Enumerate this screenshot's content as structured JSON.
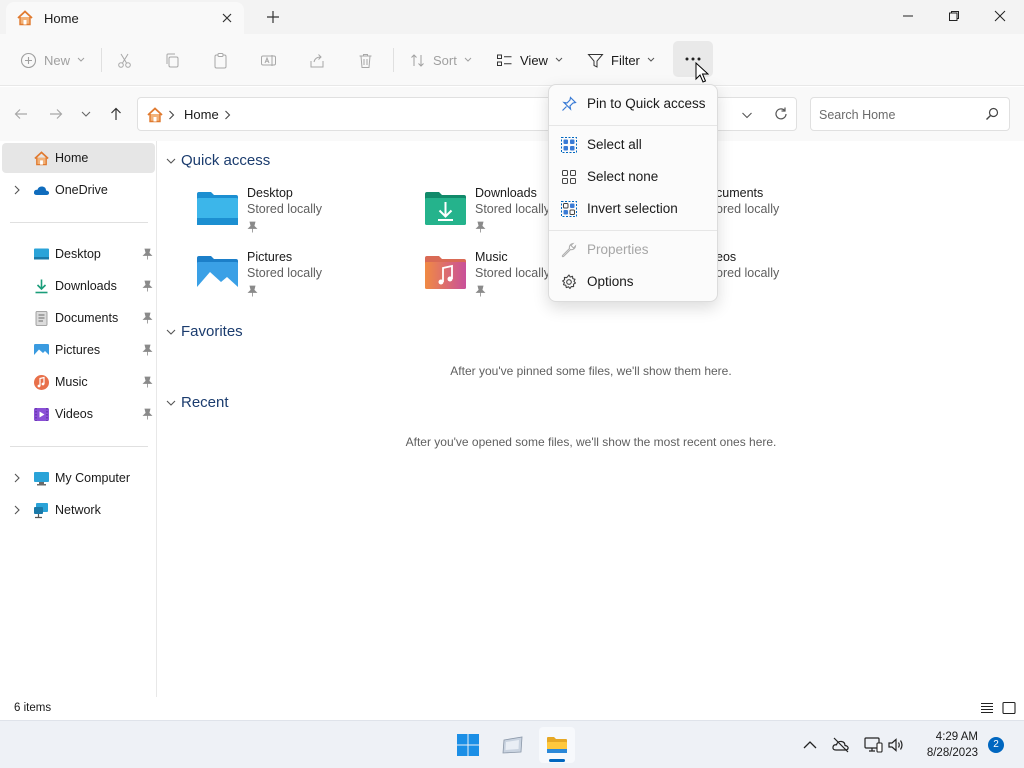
{
  "window": {
    "tab_title": "Home",
    "new_tab_label": "+"
  },
  "commandbar": {
    "new_label": "New",
    "sort_label": "Sort",
    "view_label": "View",
    "filter_label": "Filter",
    "more_label": "..."
  },
  "address": {
    "crumb": "Home",
    "search_placeholder": "Search Home"
  },
  "sidebar": {
    "home": "Home",
    "onedrive": "OneDrive",
    "desktop": "Desktop",
    "downloads": "Downloads",
    "documents": "Documents",
    "pictures": "Pictures",
    "music": "Music",
    "videos": "Videos",
    "my_computer": "My Computer",
    "network": "Network"
  },
  "content": {
    "quick_access_label": "Quick access",
    "favorites_label": "Favorites",
    "recent_label": "Recent",
    "favorites_empty": "After you've pinned some files, we'll show them here.",
    "recent_empty": "After you've opened some files, we'll show the most recent ones here.",
    "tiles": [
      {
        "name": "Desktop",
        "sub": "Stored locally"
      },
      {
        "name": "Downloads",
        "sub": "Stored locally"
      },
      {
        "name": "cuments",
        "sub": "ored locally"
      },
      {
        "name": "Pictures",
        "sub": "Stored locally"
      },
      {
        "name": "Music",
        "sub": "Stored locally"
      },
      {
        "name": "eos",
        "sub": "ored locally"
      }
    ]
  },
  "menu": {
    "pin_quick_access": "Pin to Quick access",
    "select_all": "Select all",
    "select_none": "Select none",
    "invert_selection": "Invert selection",
    "properties": "Properties",
    "options": "Options"
  },
  "status": {
    "item_count": "6 items"
  },
  "taskbar": {
    "time": "4:29 AM",
    "date": "8/28/2023",
    "notification_count": "2"
  },
  "colors": {
    "accent": "#0067c0",
    "section_header": "#1b3c6e",
    "home_icon": "#e07a2f"
  }
}
